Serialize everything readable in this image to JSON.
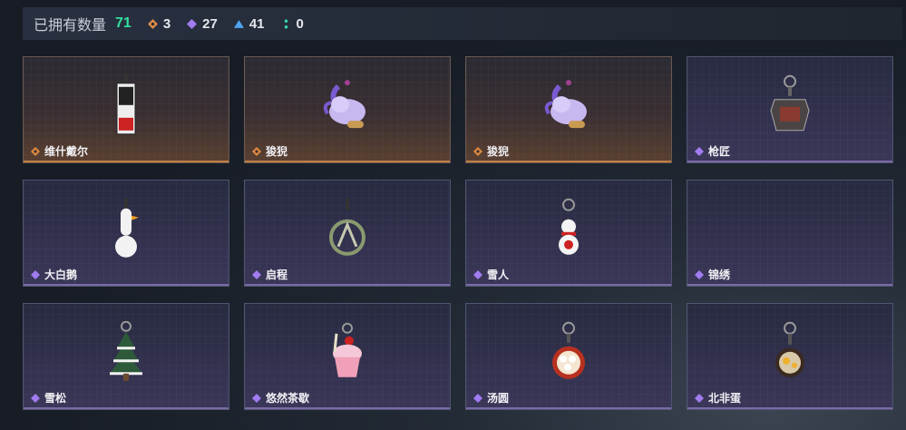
{
  "header": {
    "owned_label": "已拥有数量",
    "owned_total": "71",
    "stats": [
      {
        "icon": "orange-diamond-icon",
        "color": "#d98a4a",
        "value": "3"
      },
      {
        "icon": "purple-diamond-icon",
        "color": "#a07cf0",
        "value": "27"
      },
      {
        "icon": "blue-triangle-icon",
        "color": "#4ea4f0",
        "value": "41"
      },
      {
        "icon": "teal-dots-icon",
        "color": "#33d6b0",
        "value": "0"
      }
    ]
  },
  "items": [
    {
      "name": "维什戴尔",
      "rarity": "orange",
      "icon": "tag-keychain-icon"
    },
    {
      "name": "狻猊",
      "rarity": "orange",
      "icon": "lion-plush-icon"
    },
    {
      "name": "狻猊",
      "rarity": "orange",
      "icon": "lion-plush-icon"
    },
    {
      "name": "枪匠",
      "rarity": "purple",
      "icon": "gunsmith-badge-icon"
    },
    {
      "name": "大白鹅",
      "rarity": "purple",
      "icon": "white-goose-icon"
    },
    {
      "name": "启程",
      "rarity": "purple",
      "icon": "compass-ring-icon"
    },
    {
      "name": "雪人",
      "rarity": "purple",
      "icon": "snowman-icon"
    },
    {
      "name": "锦绣",
      "rarity": "purple",
      "icon": "empty-slot-icon"
    },
    {
      "name": "雪松",
      "rarity": "purple",
      "icon": "snowy-pine-icon"
    },
    {
      "name": "悠然茶歇",
      "rarity": "purple",
      "icon": "cupcake-icon"
    },
    {
      "name": "汤圆",
      "rarity": "purple",
      "icon": "tangyuan-bowl-icon"
    },
    {
      "name": "北非蛋",
      "rarity": "purple",
      "icon": "shakshuka-pan-icon"
    }
  ]
}
